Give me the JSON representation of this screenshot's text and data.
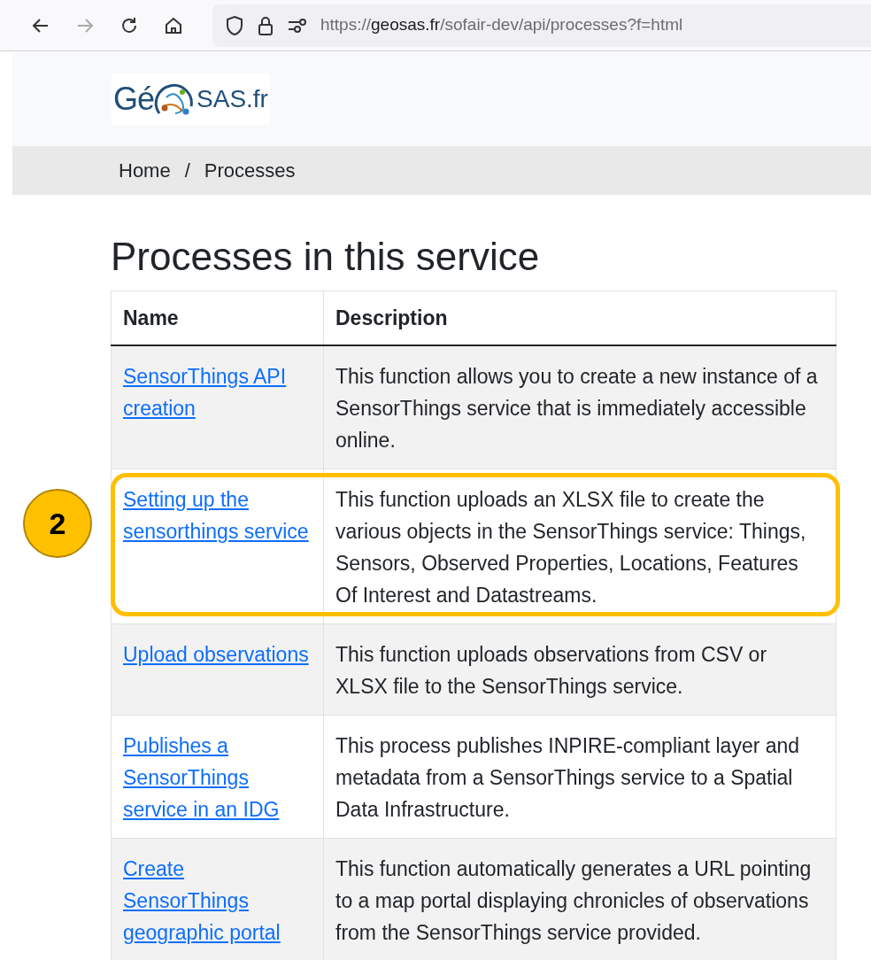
{
  "browser": {
    "url": "https://**geosas.fr**/sofair-dev/api/processes?f=html",
    "forward_disabled": true
  },
  "logo": {
    "left": "Gé",
    "right": "SAS.fr"
  },
  "breadcrumb": [
    "Home",
    "Processes"
  ],
  "breadcrumb_separator": "/",
  "title": "Processes in this service",
  "table": {
    "columns": [
      "Name",
      "Description"
    ],
    "rows": [
      {
        "name": "SensorThings API creation",
        "description": "This function allows you to create a new instance of a SensorThings service that is immediately accessible online."
      },
      {
        "name": "Setting up the sensorthings service",
        "description": "This function uploads an XLSX file to create the various objects in the SensorThings service: Things, Sensors, Observed Properties, Locations, Features Of Interest and Datastreams.",
        "callout": "2"
      },
      {
        "name": "Upload observations",
        "description": "This function uploads observations from CSV or XLSX file to the SensorThings service."
      },
      {
        "name": "Publishes a SensorThings service in an IDG",
        "description": "This process publishes INPIRE-compliant layer and metadata from a SensorThings service to a Spatial Data Infrastructure."
      },
      {
        "name": "Create SensorThings geographic portal",
        "description": "This function automatically generates a URL pointing to a map portal displaying chronicles of observations from the SensorThings service provided."
      }
    ]
  }
}
